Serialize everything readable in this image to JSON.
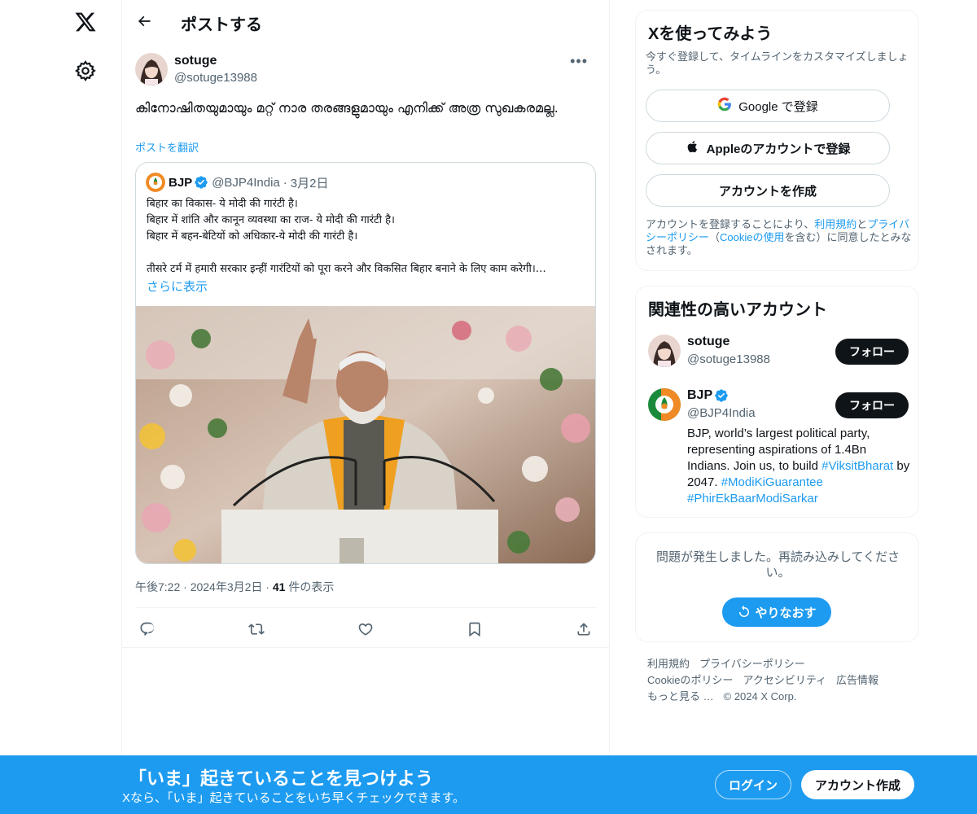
{
  "header": {
    "title": "ポストする"
  },
  "post": {
    "author_name": "sotuge",
    "author_handle": "@sotuge13988",
    "text": "കിനോഷിതയുമായും മറ്റ് നാര തരങ്ങളുമായും എനിക്ക് അത്ര സുഖകരമല്ല.",
    "translate": "ポストを翻訳",
    "timestamp": "午後7:22 · 2024年3月2日 · ",
    "views_count": "41",
    "views_label": " 件の表示"
  },
  "quote": {
    "name": "BJP",
    "handle": "@BJP4India",
    "dot": "·",
    "date": "3月2日",
    "lines": [
      "बिहार का विकास- ये मोदी की गारंटी है।",
      "बिहार में शांति और कानून व्यवस्था का राज- ये मोदी की गारंटी है।",
      "बिहार में बहन-बेटियों को अधिकार-ये मोदी की गारंटी है।",
      "",
      "तीसरे टर्म में हमारी सरकार इन्हीं गारंटियों को पूरा करने और विकसित बिहार बनाने के लिए काम करेगी।…"
    ],
    "show_more": "さらに表示"
  },
  "signup": {
    "title": "Xを使ってみよう",
    "subtitle": "今すぐ登録して、タイムラインをカスタマイズしましょう。",
    "google": "Google で登録",
    "apple": "Appleのアカウントで登録",
    "create": "アカウントを作成",
    "terms_1": "アカウントを登録することにより、",
    "terms_tos": "利用規約",
    "terms_2": "と",
    "terms_privacy": "プライバシーポリシー",
    "terms_3": "（",
    "terms_cookie": "Cookieの使用",
    "terms_4": "を含む）に同意したとみなされます。"
  },
  "related": {
    "title": "関連性の高いアカウント",
    "follow_label": "フォロー",
    "accounts": [
      {
        "name": "sotuge",
        "handle": "@sotuge13988"
      },
      {
        "name": "BJP",
        "handle": "@BJP4India",
        "bio_1": "BJP, world’s largest political party, representing aspirations of 1.4Bn Indians. Join us, to build ",
        "tag_1": "#ViksitBharat",
        "bio_2": " by 2047. ",
        "tag_2": "#ModiKiGuarantee",
        "tag_3": "#PhirEkBaarModiSarkar"
      }
    ]
  },
  "error": {
    "text": "問題が発生しました。再読み込みしてください。",
    "retry": "やりなおす"
  },
  "footer": {
    "links": [
      "利用規約",
      "プライバシーポリシー",
      "Cookieのポリシー",
      "アクセシビリティ",
      "広告情報",
      "もっと見る …",
      "© 2024 X Corp."
    ]
  },
  "banner": {
    "title": "「いま」起きていることを見つけよう",
    "subtitle": "Xなら、「いま」起きていることをいち早くチェックできます。",
    "login": "ログイン",
    "create": "アカウント作成"
  },
  "colors": {
    "accent": "#1d9bf0",
    "text": "#0f1419",
    "secondary": "#536471",
    "border": "#eff3f4"
  }
}
